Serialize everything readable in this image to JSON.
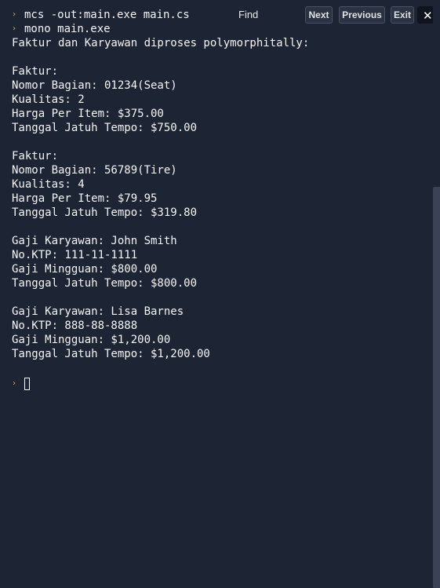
{
  "find_bar": {
    "label": "Find",
    "next": "Next",
    "previous": "Previous",
    "exit": "Exit",
    "close": "✕"
  },
  "prompt_symbol": "›",
  "commands": [
    "mcs -out:main.exe main.cs",
    "mono main.exe"
  ],
  "output_lines": [
    "Faktur dan Karyawan diproses polymorphitally:",
    "",
    "Faktur:",
    "Nomor Bagian: 01234(Seat)",
    "Kualitas: 2",
    "Harga Per Item: $375.00",
    "Tanggal Jatuh Tempo: $750.00",
    "",
    "Faktur:",
    "Nomor Bagian: 56789(Tire)",
    "Kualitas: 4",
    "Harga Per Item: $79.95",
    "Tanggal Jatuh Tempo: $319.80",
    "",
    "Gaji Karyawan: John Smith",
    "No.KTP: 111-11-1111",
    "Gaji Mingguan: $800.00",
    "Tanggal Jatuh Tempo: $800.00",
    "",
    "Gaji Karyawan: Lisa Barnes",
    "No.KTP: 888-88-8888",
    "Gaji Mingguan: $1,200.00",
    "Tanggal Jatuh Tempo: $1,200.00"
  ],
  "colors": {
    "background": "#1d2433",
    "prompt": "#e6b422",
    "text": "#f5f5f5"
  }
}
